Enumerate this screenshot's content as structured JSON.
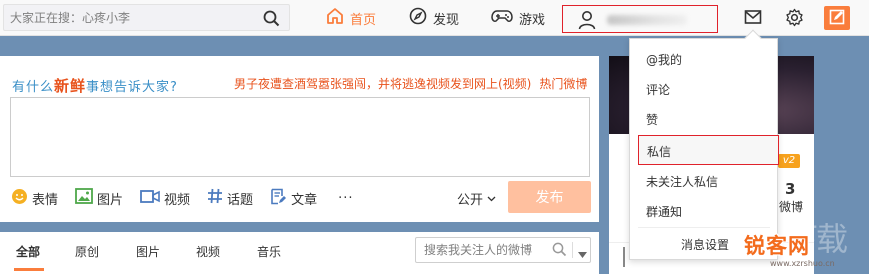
{
  "topbar": {
    "search_placeholder": "大家正在搜：心疼小李",
    "nav": {
      "home": "首页",
      "discover": "发现",
      "game": "游戏"
    }
  },
  "publish": {
    "title_parts": [
      "有什么",
      "新鲜",
      "事想告诉大家?"
    ],
    "hot_topic": "男子夜遭查酒驾嚣张强闯，并将逃逸视频发到网上(视频)",
    "hot_label": "热门微博",
    "tools": {
      "emoji": "表情",
      "image": "图片",
      "video": "视频",
      "topic": "话题",
      "article": "文章",
      "more": "···"
    },
    "visibility": "公开",
    "send_label": "发布"
  },
  "feed": {
    "tabs": [
      "全部",
      "原创",
      "图片",
      "视频",
      "音乐"
    ],
    "search_placeholder": "搜索我关注人的微博"
  },
  "side": {
    "level_badge": "v2",
    "count": "3",
    "count_label": "微博"
  },
  "dropdown": {
    "items": [
      "@我的",
      "评论",
      "赞",
      "私信",
      "未关注人私信",
      "群通知"
    ],
    "settings": "消息设置"
  },
  "watermark": {
    "big": "下载",
    "brand": "锐客网",
    "url": "www.xzrshuo.cn"
  },
  "colors": {
    "accent": "#fa7d3c",
    "highlight_border": "#e0222b",
    "title_blue": "#3a8fc7"
  }
}
